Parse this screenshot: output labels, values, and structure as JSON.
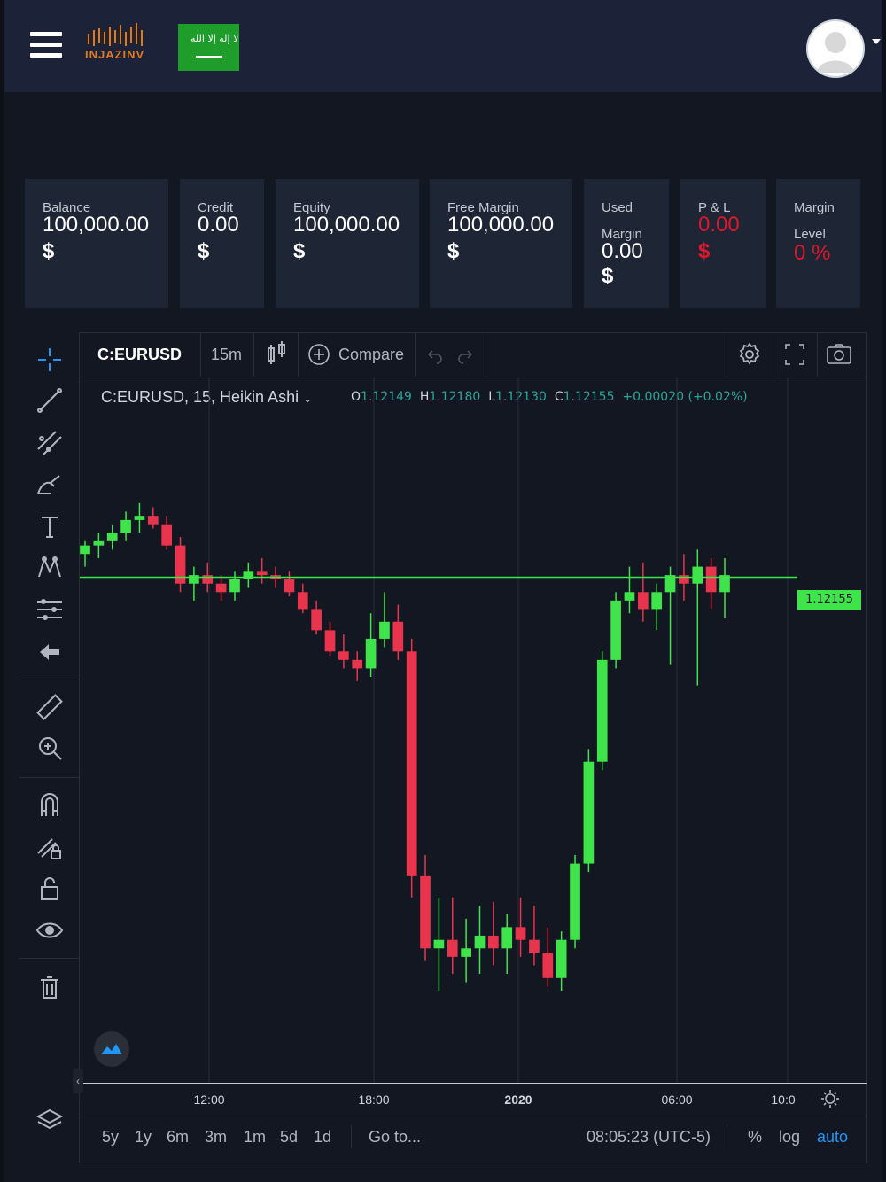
{
  "header": {
    "logo_text": "INJAZINV",
    "flag_text": "لا إله إلا الله",
    "menu_icon": "hamburger-menu-icon",
    "avatar_icon": "user-avatar-icon"
  },
  "cards": [
    {
      "label": "Balance",
      "value": "100,000.00",
      "currency": "$",
      "color": "#ffffff"
    },
    {
      "label": "Credit",
      "value": "0.00",
      "currency": "$",
      "color": "#ffffff"
    },
    {
      "label": "Equity",
      "value": "100,000.00",
      "currency": "$",
      "color": "#ffffff"
    },
    {
      "label": "Free Margin",
      "value": "100,000.00",
      "currency": "$",
      "color": "#ffffff"
    },
    {
      "label_line1": "Used",
      "label_line2": "Margin",
      "value": "0.00",
      "currency": "$",
      "color": "#ffffff"
    },
    {
      "label": "P & L",
      "value": "0.00",
      "currency": "$",
      "color": "#e0172a"
    },
    {
      "label_line1": "Margin",
      "label_line2": "Level",
      "value": "0 %",
      "color": "#e0172a"
    }
  ],
  "chart_toolbar": {
    "symbol": "C:EURUSD",
    "interval": "15m",
    "compare": "Compare"
  },
  "legend": {
    "title": "C:EURUSD, 15, Heikin Ashi",
    "o_key": "O",
    "o_val": "1.12149",
    "h_key": "H",
    "h_val": "1.12180",
    "l_key": "L",
    "l_val": "1.12130",
    "c_key": "C",
    "c_val": "1.12155",
    "change": "+0.00020 (+0.02%)"
  },
  "price_label": "1.12155",
  "xaxis": {
    "ticks": [
      "12:00",
      "18:00",
      "2020",
      "06:00",
      "10:0"
    ]
  },
  "bottom_bar": {
    "ranges": [
      "5y",
      "1y",
      "6m",
      "3m",
      "1m",
      "5d",
      "1d"
    ],
    "goto": "Go to...",
    "clock": "08:05:23 (UTC-5)",
    "percent": "%",
    "log": "log",
    "auto": "auto"
  },
  "colors": {
    "up": "#3fe44b",
    "down": "#e8344d",
    "accent": "#2196f3",
    "header_bg": "#1c2338",
    "card_bg": "#1e2535"
  },
  "chart_data": {
    "type": "candlestick",
    "symbol": "C:EURUSD",
    "last_price": 1.12155,
    "candles": [
      [
        1.1221,
        1.1224,
        1.1218,
        1.1223,
        1
      ],
      [
        1.1223,
        1.1226,
        1.122,
        1.1224,
        1
      ],
      [
        1.1224,
        1.1228,
        1.1222,
        1.1226,
        1
      ],
      [
        1.1226,
        1.1231,
        1.1224,
        1.1229,
        1
      ],
      [
        1.1229,
        1.1233,
        1.1226,
        1.123,
        1
      ],
      [
        1.123,
        1.1232,
        1.1227,
        1.1228,
        0
      ],
      [
        1.1228,
        1.123,
        1.1222,
        1.1223,
        0
      ],
      [
        1.1223,
        1.1225,
        1.1212,
        1.1214,
        0
      ],
      [
        1.1214,
        1.1218,
        1.121,
        1.1216,
        1
      ],
      [
        1.1216,
        1.1219,
        1.1212,
        1.1214,
        0
      ],
      [
        1.1214,
        1.1216,
        1.121,
        1.1212,
        0
      ],
      [
        1.1212,
        1.1217,
        1.121,
        1.1215,
        1
      ],
      [
        1.1215,
        1.1219,
        1.1213,
        1.1217,
        1
      ],
      [
        1.1217,
        1.122,
        1.1214,
        1.1216,
        0
      ],
      [
        1.1216,
        1.1218,
        1.1213,
        1.1215,
        0
      ],
      [
        1.1215,
        1.1217,
        1.1211,
        1.1212,
        0
      ],
      [
        1.1212,
        1.1214,
        1.1207,
        1.1208,
        0
      ],
      [
        1.1208,
        1.121,
        1.1202,
        1.1203,
        0
      ],
      [
        1.1203,
        1.1205,
        1.1197,
        1.1198,
        0
      ],
      [
        1.1198,
        1.1202,
        1.1194,
        1.1196,
        0
      ],
      [
        1.1196,
        1.1198,
        1.1191,
        1.1194,
        0
      ],
      [
        1.1194,
        1.1207,
        1.1192,
        1.1201,
        1
      ],
      [
        1.1201,
        1.1212,
        1.1199,
        1.1205,
        1
      ],
      [
        1.1205,
        1.1209,
        1.1196,
        1.1198,
        0
      ],
      [
        1.1198,
        1.1201,
        1.114,
        1.1145,
        0
      ],
      [
        1.1145,
        1.115,
        1.1125,
        1.1128,
        0
      ],
      [
        1.1128,
        1.114,
        1.1118,
        1.113,
        1
      ],
      [
        1.113,
        1.114,
        1.1122,
        1.1126,
        0
      ],
      [
        1.1126,
        1.1135,
        1.112,
        1.1128,
        1
      ],
      [
        1.1128,
        1.1138,
        1.1122,
        1.1131,
        1
      ],
      [
        1.1131,
        1.1139,
        1.1124,
        1.1128,
        0
      ],
      [
        1.1128,
        1.1136,
        1.1122,
        1.1133,
        1
      ],
      [
        1.1133,
        1.114,
        1.1126,
        1.113,
        0
      ],
      [
        1.113,
        1.1138,
        1.1124,
        1.1127,
        0
      ],
      [
        1.1127,
        1.1133,
        1.1119,
        1.1121,
        0
      ],
      [
        1.1121,
        1.1132,
        1.1118,
        1.113,
        1
      ],
      [
        1.113,
        1.115,
        1.1128,
        1.1148,
        1
      ],
      [
        1.1148,
        1.1175,
        1.1146,
        1.1172,
        1
      ],
      [
        1.1172,
        1.1198,
        1.117,
        1.1196,
        1
      ],
      [
        1.1196,
        1.1212,
        1.1194,
        1.121,
        1
      ],
      [
        1.121,
        1.1218,
        1.1207,
        1.1212,
        1
      ],
      [
        1.1212,
        1.1219,
        1.1205,
        1.1208,
        0
      ],
      [
        1.1208,
        1.1214,
        1.1203,
        1.1212,
        1
      ],
      [
        1.1212,
        1.1218,
        1.1195,
        1.1216,
        1
      ],
      [
        1.1216,
        1.1221,
        1.121,
        1.1214,
        0
      ],
      [
        1.1214,
        1.1222,
        1.119,
        1.1218,
        1
      ],
      [
        1.1218,
        1.122,
        1.1208,
        1.1212,
        0
      ],
      [
        1.1212,
        1.122,
        1.1206,
        1.1216,
        1
      ]
    ]
  }
}
